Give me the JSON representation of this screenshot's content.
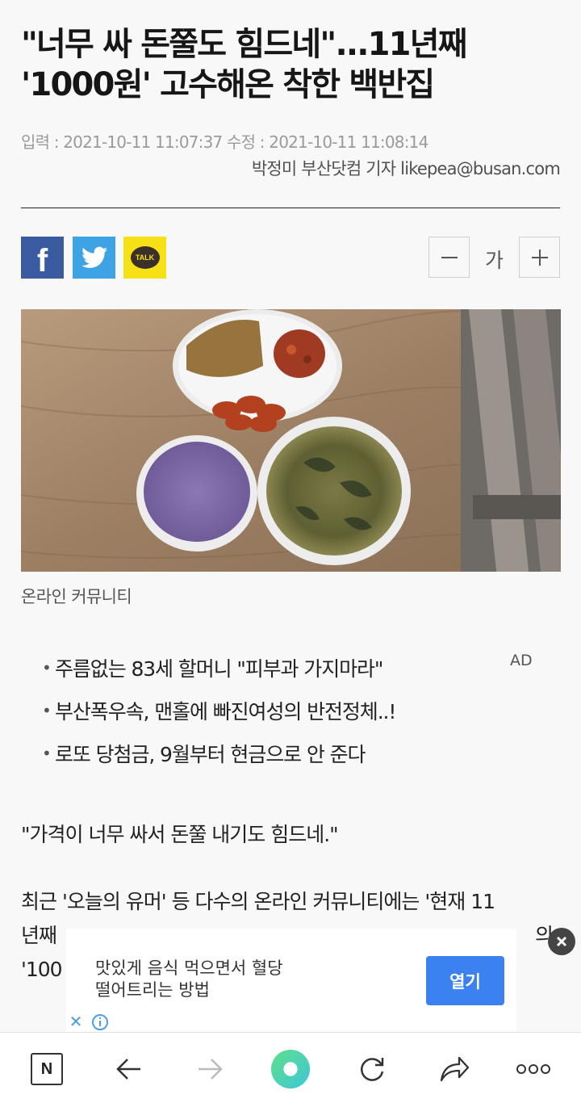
{
  "article": {
    "headline_line1": "\"너무 싸 돈쭐도 힘드네\"...11년째",
    "headline_line2": "'1000원' 고수해온 착한 백반집",
    "dateline": "입력 : 2021-10-11 11:07:37 수정 : 2021-10-11 11:08:14",
    "byline": "박정미 부산닷컴 기자 likepea@busan.com",
    "photo_caption": "온라인 커뮤니티",
    "paragraph1": "\"가격이 너무 싸서 돈쭐 내기도 힘드네.\"",
    "paragraph2_line1": "최근 '오늘의 유머' 등 다수의 온라인 커뮤니티에는 '현재 11",
    "paragraph2_line2": "년째",
    "paragraph2_line2_end": "의",
    "paragraph2_line3": "'100"
  },
  "share": {
    "facebook_icon": "facebook-icon",
    "twitter_icon": "twitter-icon",
    "kakaotalk_label": "TALK"
  },
  "font_control": {
    "minus_icon": "minus-icon",
    "label": "가",
    "plus_icon": "plus-icon"
  },
  "related": {
    "ad_label": "AD",
    "items": [
      {
        "text": "주름없는 83세 할머니 \"피부과 가지마라\""
      },
      {
        "text": "부산폭우속, 맨홀에 빠진여성의 반전정체..!"
      },
      {
        "text": "로또 당첨금, 9월부터 현금으로 안 준다"
      }
    ]
  },
  "ad_banner": {
    "text_line1": "맛있게 음식 먹으면서 혈당",
    "text_line2": "떨어트리는 방법",
    "button_label": "열기"
  },
  "browser_bar": {
    "n_label": "N",
    "icons": [
      "naver-n-icon",
      "back-arrow-icon",
      "forward-arrow-icon",
      "home-circle-icon",
      "reload-icon",
      "share-icon",
      "more-icon"
    ]
  },
  "colors": {
    "facebook": "#3b5ba0",
    "twitter": "#3ea3e5",
    "kakao": "#f6e116",
    "ad_button": "#3b82f0"
  }
}
